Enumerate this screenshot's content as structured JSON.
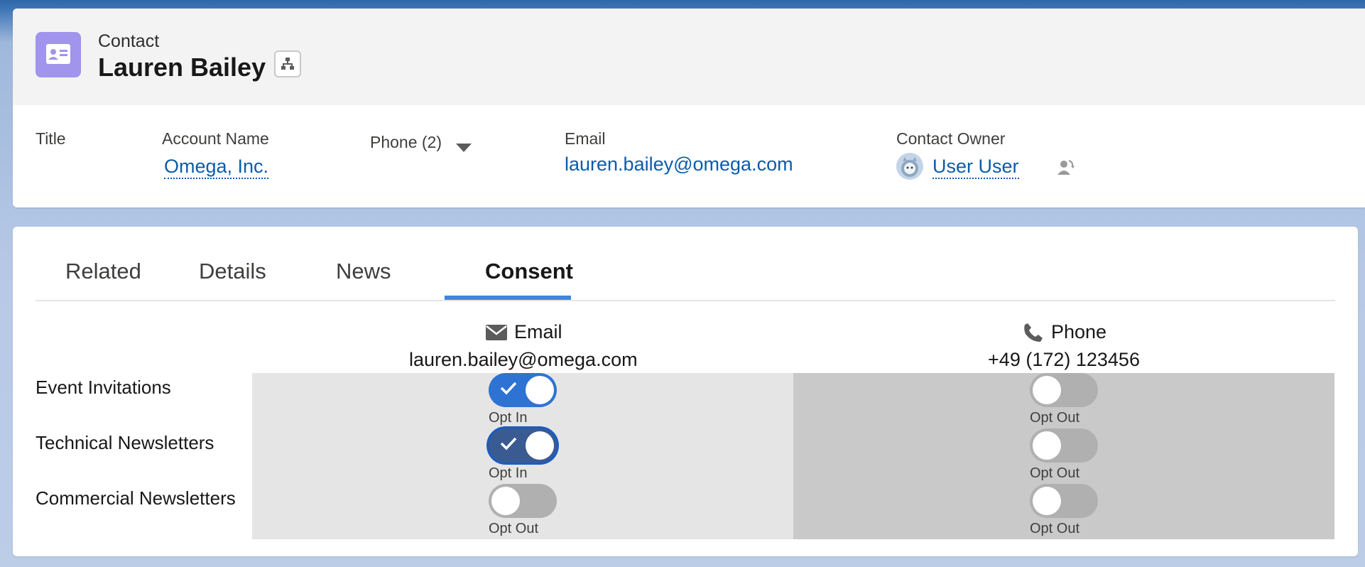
{
  "header": {
    "object_type": "Contact",
    "record_name": "Lauren Bailey",
    "fields": {
      "title_label": "Title",
      "account_label": "Account Name",
      "account_value": "Omega, Inc.",
      "phone_label": "Phone (2)",
      "email_label": "Email",
      "email_value": "lauren.bailey@omega.com",
      "owner_label": "Contact Owner",
      "owner_value": "User User"
    }
  },
  "tabs": [
    {
      "label": "Related",
      "active": false
    },
    {
      "label": "Details",
      "active": false
    },
    {
      "label": "News",
      "active": false
    },
    {
      "label": "Consent",
      "active": true
    }
  ],
  "consent": {
    "channels": [
      {
        "name": "Email",
        "icon": "envelope-icon",
        "value": "lauren.bailey@omega.com"
      },
      {
        "name": "Phone",
        "icon": "phone-icon",
        "value": "+49 (172) 123456"
      }
    ],
    "rows": [
      {
        "label": "Event Invitations",
        "email": {
          "on": true,
          "text": "Opt In"
        },
        "phone": {
          "on": false,
          "text": "Opt Out"
        }
      },
      {
        "label": "Technical Newsletters",
        "email": {
          "on": true,
          "text": "Opt In"
        },
        "phone": {
          "on": false,
          "text": "Opt Out"
        }
      },
      {
        "label": "Commercial Newsletters",
        "email": {
          "on": false,
          "text": "Opt Out"
        },
        "phone": {
          "on": false,
          "text": "Opt Out"
        }
      }
    ]
  },
  "colors": {
    "accent": "#0b5cab",
    "toggle_on": "#2e73d3",
    "toggle_off": "#b0b0b0",
    "icon_bg": "#a094ed",
    "tab_underline": "#3e86e0"
  }
}
